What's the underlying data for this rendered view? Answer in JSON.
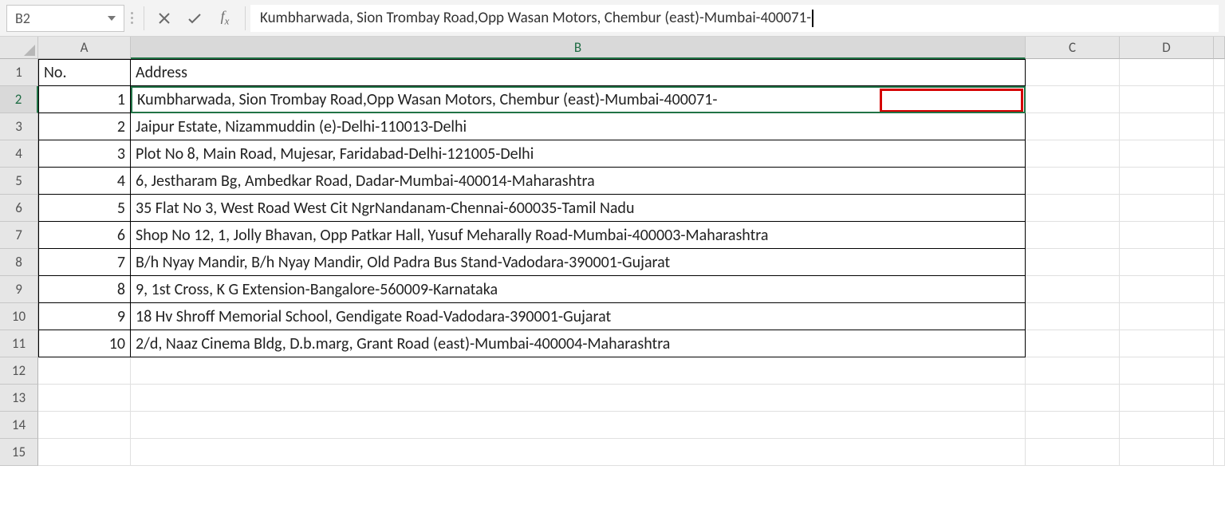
{
  "formula_bar": {
    "name_box": "B2",
    "formula": "Kumbharwada, Sion Trombay Road,Opp Wasan Motors, Chembur (east)-Mumbai-400071-"
  },
  "columns": [
    "A",
    "B",
    "C",
    "D"
  ],
  "row_numbers": [
    "1",
    "2",
    "3",
    "4",
    "5",
    "6",
    "7",
    "8",
    "9",
    "10",
    "11",
    "12",
    "13",
    "14",
    "15"
  ],
  "headers": {
    "A": "No.",
    "B": "Address"
  },
  "data": [
    {
      "no": "1",
      "address": "Kumbharwada, Sion Trombay Road,Opp Wasan Motors, Chembur (east)-Mumbai-400071-"
    },
    {
      "no": "2",
      "address": "Jaipur Estate, Nizammuddin (e)-Delhi-110013-Delhi"
    },
    {
      "no": "3",
      "address": "Plot No 8, Main Road, Mujesar, Faridabad-Delhi-121005-Delhi"
    },
    {
      "no": "4",
      "address": "6, Jestharam Bg, Ambedkar Road, Dadar-Mumbai-400014-Maharashtra"
    },
    {
      "no": "5",
      "address": "35 Flat No 3, West Road West Cit NgrNandanam-Chennai-600035-Tamil Nadu"
    },
    {
      "no": "6",
      "address": "Shop No 12, 1, Jolly Bhavan, Opp Patkar Hall, Yusuf Meharally Road-Mumbai-400003-Maharashtra"
    },
    {
      "no": "7",
      "address": "B/h Nyay Mandir, B/h Nyay Mandir, Old Padra Bus Stand-Vadodara-390001-Gujarat"
    },
    {
      "no": "8",
      "address": "9, 1st Cross, K G Extension-Bangalore-560009-Karnataka"
    },
    {
      "no": "9",
      "address": "18 Hv Shroff Memorial School, Gendigate Road-Vadodara-390001-Gujarat"
    },
    {
      "no": "10",
      "address": "2/d, Naaz Cinema Bldg, D.b.marg, Grant Road (east)-Mumbai-400004-Maharashtra"
    }
  ],
  "active_cell": "B2"
}
